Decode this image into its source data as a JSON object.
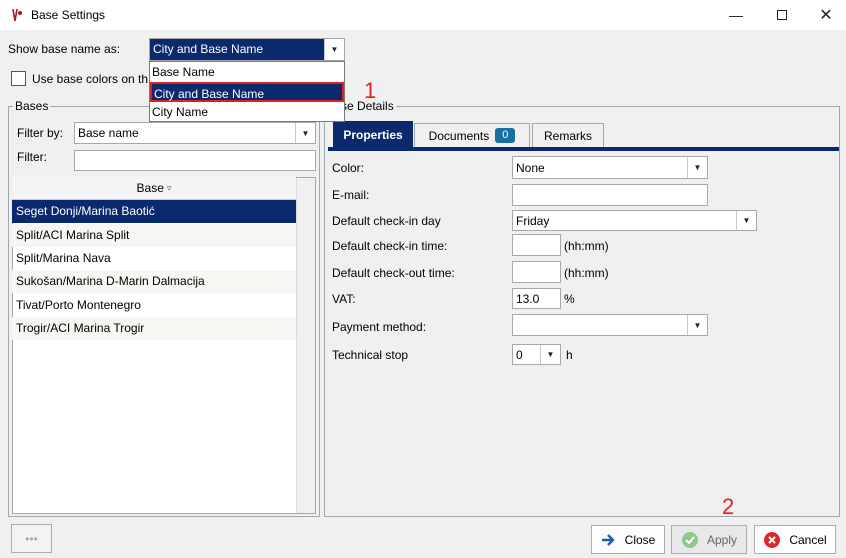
{
  "window": {
    "title": "Base Settings",
    "controls": [
      "minimize-icon",
      "maximize-icon",
      "close-icon"
    ]
  },
  "show_base_name": {
    "label": "Show base name as:",
    "selected": "City and Base Name",
    "options": [
      "Base Name",
      "City and Base Name",
      "City Name"
    ]
  },
  "use_base_colors": {
    "label": "Use base colors on th",
    "checked": false
  },
  "bases": {
    "group_title": "Bases",
    "filter_by_label": "Filter by:",
    "filter_by_value": "Base name",
    "filter_label": "Filter:",
    "filter_value": "",
    "column_header": "Base",
    "rows": [
      "Seget Donji/Marina Baotić",
      "Split/ACI Marina Split",
      "Split/Marina Nava",
      "Sukošan/Marina D-Marin Dalmacija",
      "Tivat/Porto Montenegro",
      "Trogir/ACI Marina Trogir"
    ],
    "selected_index": 0
  },
  "details": {
    "group_title": "se Details",
    "tabs": {
      "properties": "Properties",
      "documents": "Documents",
      "documents_count": "0",
      "remarks": "Remarks"
    },
    "color_label": "Color:",
    "color_value": "None",
    "email_label": "E-mail:",
    "email_value": "",
    "checkin_day_label": "Default check-in day",
    "checkin_day_value": "Friday",
    "checkin_time_label": "Default check-in time:",
    "checkin_time_value": "",
    "checkout_time_label": "Default check-out time:",
    "checkout_time_value": "",
    "time_hint": "(hh:mm)",
    "vat_label": "VAT:",
    "vat_value": "13.0",
    "vat_unit": "%",
    "payment_label": "Payment method:",
    "payment_value": "",
    "techstop_label": "Technical stop",
    "techstop_value": "0",
    "techstop_unit": "h"
  },
  "annotations": {
    "step1": "1",
    "step2": "2"
  },
  "buttons": {
    "more": "•••",
    "close": "Close",
    "apply": "Apply",
    "cancel": "Cancel"
  },
  "colors": {
    "selection": "#0b2a6e",
    "annotation": "#e02020",
    "badge": "#1a6e9e"
  }
}
